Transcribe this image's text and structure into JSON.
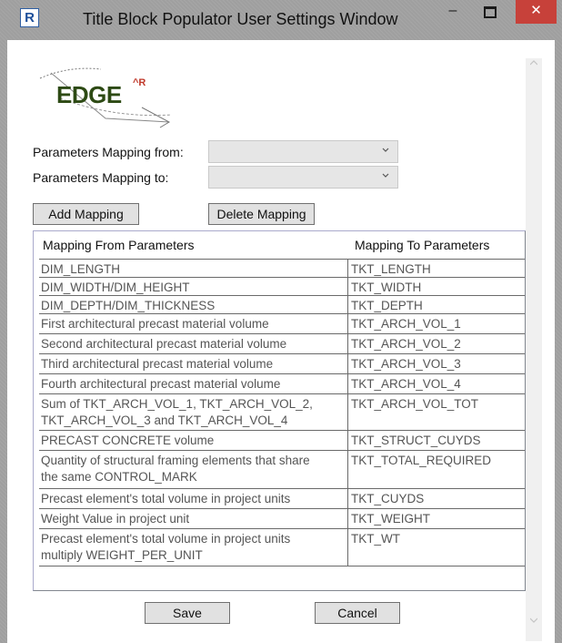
{
  "window": {
    "title": "Title Block Populator User Settings Window",
    "app_icon": "R",
    "minimize": "–",
    "close": "✕"
  },
  "logo": {
    "text": "EDGE",
    "superscript": "^R"
  },
  "form": {
    "from_label": "Parameters Mapping from:",
    "to_label": "Parameters Mapping to:",
    "from_value": "",
    "to_value": ""
  },
  "buttons": {
    "add": "Add Mapping",
    "delete": "Delete Mapping",
    "save": "Save",
    "cancel": "Cancel"
  },
  "table": {
    "columns": [
      "Mapping From Parameters",
      "Mapping To Parameters"
    ],
    "rows": [
      {
        "from": "DIM_LENGTH",
        "to": "TKT_LENGTH"
      },
      {
        "from": "DIM_WIDTH/DIM_HEIGHT",
        "to": "TKT_WIDTH"
      },
      {
        "from": "DIM_DEPTH/DIM_THICKNESS",
        "to": "TKT_DEPTH"
      },
      {
        "from": "First architectural precast material volume",
        "to": "TKT_ARCH_VOL_1"
      },
      {
        "from": "Second architectural precast material volume",
        "to": "TKT_ARCH_VOL_2"
      },
      {
        "from": "Third architectural precast material volume",
        "to": "TKT_ARCH_VOL_3"
      },
      {
        "from": "Fourth architectural precast material volume",
        "to": "TKT_ARCH_VOL_4"
      },
      {
        "from_1": "Sum of TKT_ARCH_VOL_1, TKT_ARCH_VOL_2,",
        "from_2": "TKT_ARCH_VOL_3 and TKT_ARCH_VOL_4",
        "to": "TKT_ARCH_VOL_TOT"
      },
      {
        "from": "PRECAST CONCRETE volume",
        "to": "TKT_STRUCT_CUYDS"
      },
      {
        "from_1": "Quantity of structural framing elements that share",
        "from_2": "the same CONTROL_MARK",
        "to": "TKT_TOTAL_REQUIRED"
      },
      {
        "from": "Precast element's total volume in project units",
        "to": "TKT_CUYDS"
      },
      {
        "from": "Weight Value in project unit",
        "to": "TKT_WEIGHT"
      },
      {
        "from_1": "Precast element's total volume in project units",
        "from_2": "multiply WEIGHT_PER_UNIT",
        "to": "TKT_WT"
      }
    ]
  },
  "icons": {
    "dropdown": "chevron-down-icon",
    "scroll_up": "scroll-up-arrow-icon",
    "scroll_down": "scroll-down-arrow-icon"
  },
  "colors": {
    "close_button": "#c7413a",
    "logo_green": "#2d4a14",
    "logo_red": "#c0392b",
    "app_icon_blue": "#1d4f9a"
  }
}
